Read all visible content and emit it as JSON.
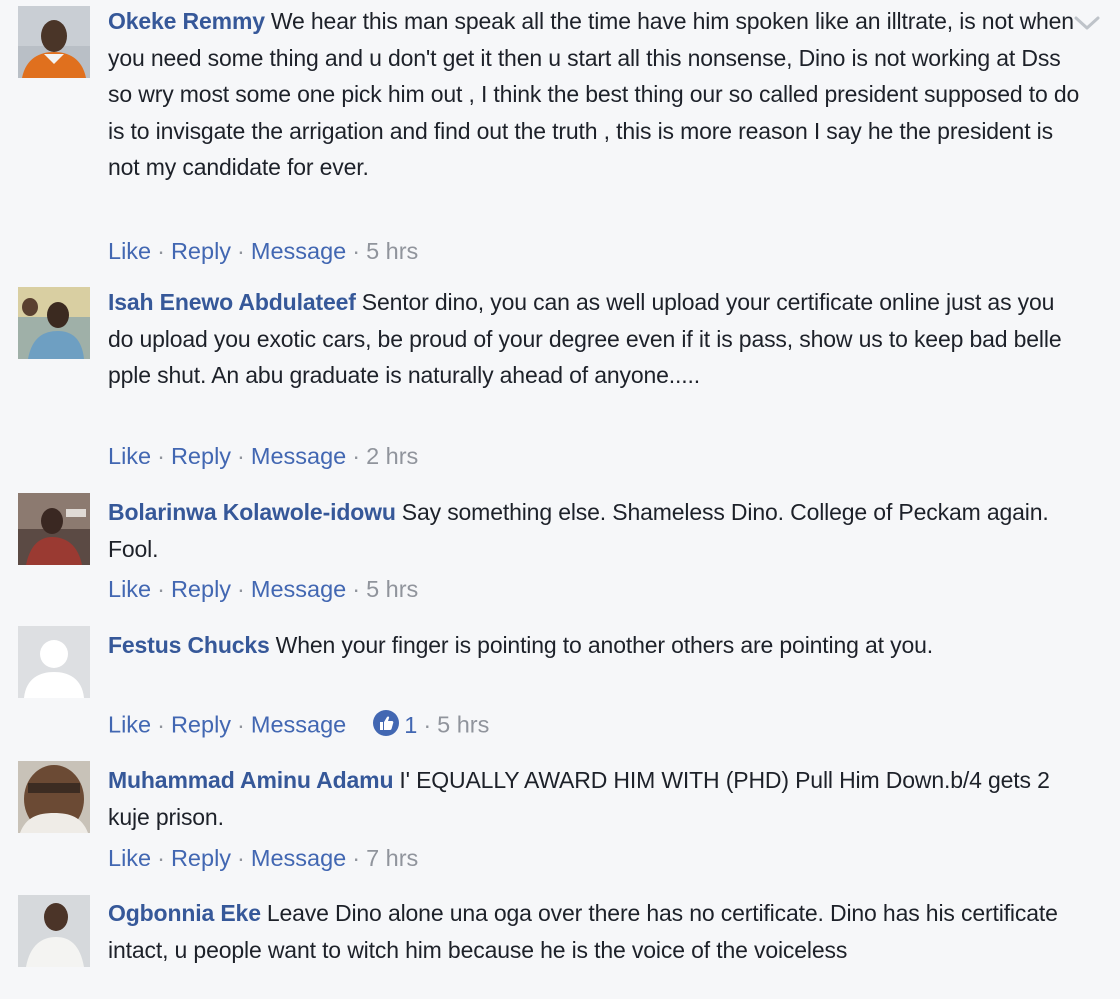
{
  "actions": {
    "like": "Like",
    "reply": "Reply",
    "message": "Message",
    "sep": "·"
  },
  "comments": [
    {
      "author": "Okeke Remmy",
      "text": "We hear this man speak all the time have him spoken like an illtrate, is not when you need some thing and u don't get it then u start all this nonsense, Dino is not working at Dss so wry most some one pick him out , I think the best thing our so called president supposed to do is to invisgate the arrigation and find out the truth , this is more reason I say he the president is not my candidate for ever.",
      "time": "5 hrs"
    },
    {
      "author": "Isah Enewo Abdulateef",
      "text": "Sentor dino, you can as well upload your certificate online just as you do upload you exotic cars, be proud of your degree even if it is pass, show us to keep bad belle pple shut. An abu graduate is naturally ahead of anyone.....",
      "time": "2 hrs"
    },
    {
      "author": "Bolarinwa Kolawole-idowu",
      "text": "Say something else. Shameless Dino. College of Peckam again. Fool.",
      "time": "5 hrs"
    },
    {
      "author": "Festus Chucks",
      "text": "When your finger is pointing to another others are pointing at you.",
      "reaction_count": "1",
      "time": "5 hrs"
    },
    {
      "author": "Muhammad Aminu Adamu",
      "text": "I' EQUALLY AWARD HIM WITH (PHD) Pull Him Down.b/4 gets 2 kuje prison.",
      "time": "7 hrs"
    },
    {
      "author": "Ogbonnia Eke",
      "text": "Leave Dino alone una oga over there has no certificate. Dino has his certificate intact, u people want to witch him because he is the voice of the voiceless"
    }
  ],
  "icons": {
    "options_menu": "chevron-down-icon",
    "reaction": "like-reaction-icon",
    "avatar_default": "default-avatar-icon"
  },
  "colors": {
    "author": "#365899",
    "link": "#4267b2",
    "meta": "#90949c",
    "text": "#1d2129",
    "background": "#f6f7f9"
  }
}
